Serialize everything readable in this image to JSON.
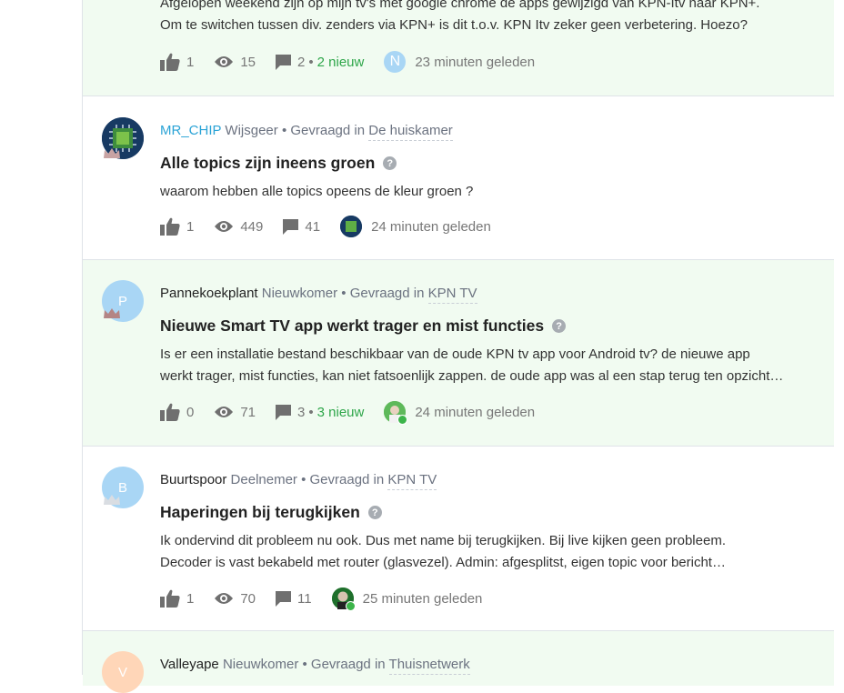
{
  "topics": [
    {
      "excerpt_line1": "Afgelopen weekend zijn op mijn tv's met google chrome de apps gewijzigd van KPN-Itv naar KPN+.",
      "excerpt_line2": "Om te switchen tussen div. zenders via KPN+ is dit t.o.v. KPN Itv zeker geen verbetering. Hoezo?",
      "likes": "1",
      "views": "15",
      "replies": "2",
      "new_text": "2 nieuw",
      "last_avatar_letter": "N",
      "time": "23 minuten geleden"
    },
    {
      "username": "MR_CHIP",
      "rank": "Wijsgeer",
      "asked_in": "• Gevraagd in",
      "category": "De huiskamer",
      "title": "Alle topics zijn ineens groen",
      "excerpt_line1": "waarom hebben alle topics opeens de kleur groen ?",
      "likes": "1",
      "views": "449",
      "replies": "41",
      "time": "24 minuten geleden"
    },
    {
      "avatar_letter": "P",
      "username": "Pannekoekplant",
      "rank": "Nieuwkomer",
      "asked_in": "• Gevraagd in",
      "category": "KPN TV",
      "title": "Nieuwe Smart TV app werkt trager en mist functies",
      "excerpt_line1": "Is er een installatie bestand beschikbaar van de oude KPN tv app voor Android tv? de nieuwe app",
      "excerpt_line2": "werkt trager, mist functies, kan niet fatsoenlijk zappen. de oude app was al een stap terug ten opzicht…",
      "likes": "0",
      "views": "71",
      "replies": "3",
      "new_text": "3 nieuw",
      "time": "24 minuten geleden"
    },
    {
      "avatar_letter": "B",
      "username": "Buurtspoor",
      "rank": "Deelnemer",
      "asked_in": "• Gevraagd in",
      "category": "KPN TV",
      "title": "Haperingen bij terugkijken",
      "excerpt_line1": "Ik ondervind dit probleem nu ook. Dus met name bij terugkijken. Bij live kijken geen probleem.",
      "excerpt_line2": "Decoder is vast bekabeld met router (glasvezel). Admin: afgesplitst, eigen topic voor bericht…",
      "likes": "1",
      "views": "70",
      "replies": "11",
      "time": "25 minuten geleden"
    },
    {
      "avatar_letter": "V",
      "username": "Valleyape",
      "rank": "Nieuwkomer",
      "asked_in": "• Gevraagd in",
      "category": "Thuisnetwerk"
    }
  ],
  "question_mark": "?",
  "colors": {
    "accent_green": "#2ea64a",
    "link_blue": "#2aa3d6",
    "row_green_bg": "#f1fbf1"
  }
}
